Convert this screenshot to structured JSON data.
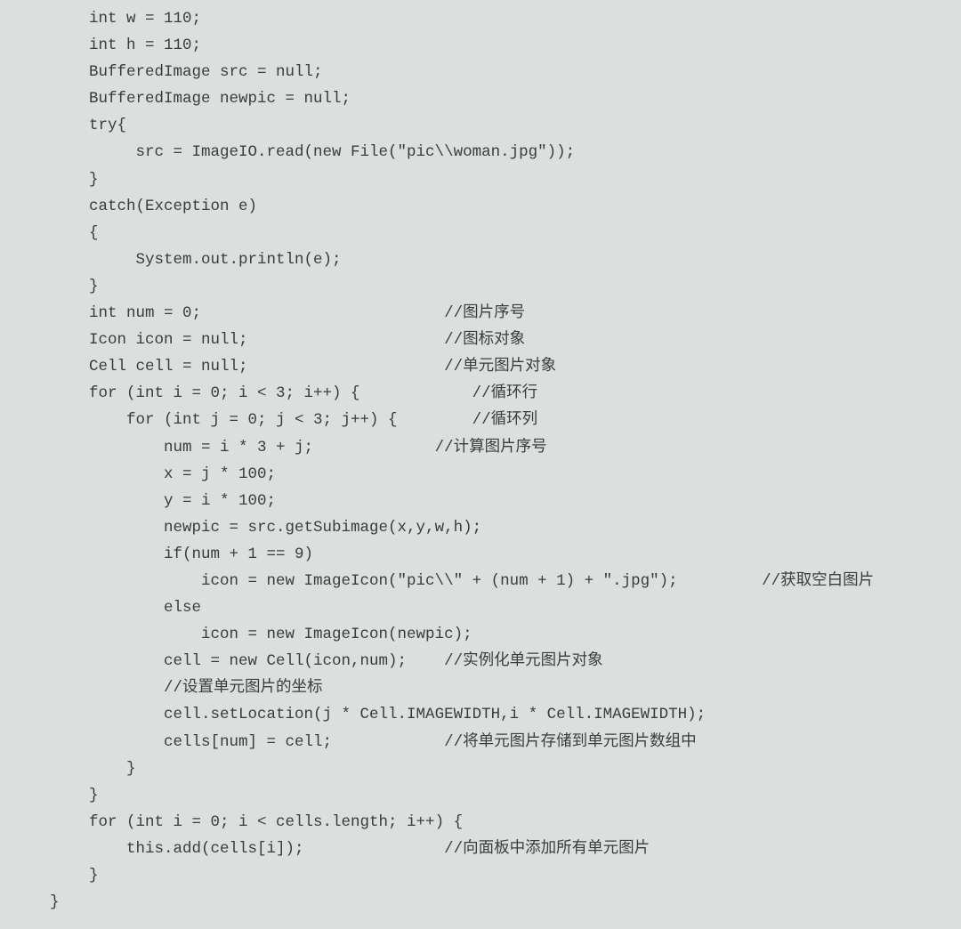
{
  "code_lines": [
    "int w = 110;",
    "int h = 110;",
    "BufferedImage src = null;",
    "BufferedImage newpic = null;",
    "try{",
    "     src = ImageIO.read(new File(\"pic\\\\woman.jpg\"));",
    "}",
    "catch(Exception e)",
    "{",
    "     System.out.println(e);",
    "}",
    "int num = 0;                          //图片序号",
    "Icon icon = null;                     //图标对象",
    "Cell cell = null;                     //单元图片对象",
    "for (int i = 0; i < 3; i++) {            //循环行",
    "    for (int j = 0; j < 3; j++) {        //循环列",
    "        num = i * 3 + j;             //计算图片序号",
    "        x = j * 100;",
    "        y = i * 100;",
    "        newpic = src.getSubimage(x,y,w,h);",
    "        if(num + 1 == 9)",
    "            icon = new ImageIcon(\"pic\\\\\" + (num + 1) + \".jpg\");         //获取空白图片",
    "        else",
    "            icon = new ImageIcon(newpic);",
    "        cell = new Cell(icon,num);    //实例化单元图片对象",
    "        //设置单元图片的坐标",
    "        cell.setLocation(j * Cell.IMAGEWIDTH,i * Cell.IMAGEWIDTH);",
    "        cells[num] = cell;            //将单元图片存储到单元图片数组中",
    "    }",
    "}",
    "for (int i = 0; i < cells.length; i++) {",
    "    this.add(cells[i]);               //向面板中添加所有单元图片",
    "}"
  ],
  "closing_brace": "}"
}
